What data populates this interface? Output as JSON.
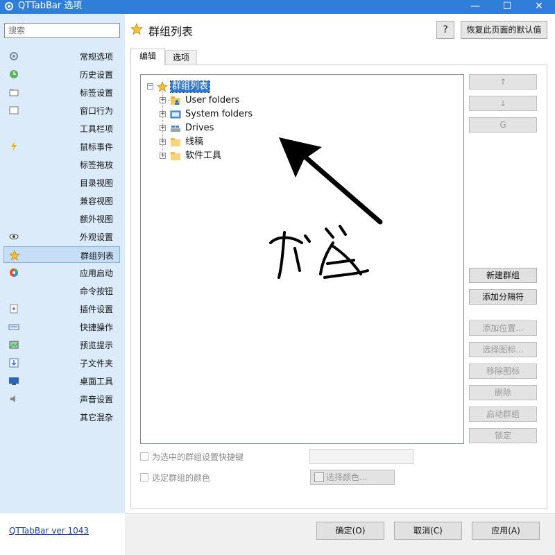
{
  "window": {
    "title": "QTTabBar 选项",
    "controls": {
      "minimize": "—",
      "maximize": "☐",
      "close": "✕"
    }
  },
  "sidebar": {
    "search_placeholder": "搜索",
    "items": [
      {
        "label": "常规选项",
        "icon": "gear-icon",
        "selected": false
      },
      {
        "label": "历史设置",
        "icon": "history-icon",
        "selected": false
      },
      {
        "label": "标签设置",
        "icon": "tab-icon",
        "selected": false
      },
      {
        "label": "窗口行为",
        "icon": "window-icon",
        "selected": false
      },
      {
        "label": "工具栏项",
        "icon": "",
        "selected": false
      },
      {
        "label": "鼠标事件",
        "icon": "lightning-icon",
        "selected": false
      },
      {
        "label": "标签拖放",
        "icon": "",
        "selected": false
      },
      {
        "label": "目录视图",
        "icon": "",
        "selected": false
      },
      {
        "label": "兼容视图",
        "icon": "",
        "selected": false
      },
      {
        "label": "额外视图",
        "icon": "",
        "selected": false
      },
      {
        "label": "外观设置",
        "icon": "eye-icon",
        "selected": false
      },
      {
        "label": "群组列表",
        "icon": "star-icon",
        "selected": true
      },
      {
        "label": "应用启动",
        "icon": "app-launch-icon",
        "selected": false
      },
      {
        "label": "命令按钮",
        "icon": "",
        "selected": false
      },
      {
        "label": "插件设置",
        "icon": "plugin-icon",
        "selected": false
      },
      {
        "label": "快捷操作",
        "icon": "keyboard-icon",
        "selected": false
      },
      {
        "label": "预览提示",
        "icon": "image-preview-icon",
        "selected": false
      },
      {
        "label": "子文件夹",
        "icon": "subfolder-arrow-icon",
        "selected": false
      },
      {
        "label": "桌面工具",
        "icon": "desktop-icon",
        "selected": false
      },
      {
        "label": "声音设置",
        "icon": "speaker-icon",
        "selected": false
      },
      {
        "label": "其它混杂",
        "icon": "",
        "selected": false
      }
    ],
    "version_link": "QTTabBar ver 1043"
  },
  "page": {
    "title": "群组列表",
    "help_label": "?",
    "reset_label": "恢复此页面的默认值",
    "tabs": [
      {
        "label": "编辑",
        "active": true
      },
      {
        "label": "选项",
        "active": false
      }
    ]
  },
  "tree": {
    "root": "群组列表",
    "children": [
      {
        "label": "User folders",
        "icon": "user-folder-icon"
      },
      {
        "label": "System folders",
        "icon": "system-folder-icon"
      },
      {
        "label": "Drives",
        "icon": "drive-icon"
      },
      {
        "label": "线稿",
        "icon": "folder-icon"
      },
      {
        "label": "软件工具",
        "icon": "folder-icon"
      }
    ]
  },
  "right_buttons": {
    "up": "↑",
    "down": "↓",
    "reset": "G",
    "new_group": "新建群组",
    "add_separator": "添加分隔符",
    "add_location": "添加位置...",
    "select_icon": "选择图标...",
    "remove_icon": "移除图标",
    "delete": "删除",
    "launch_group": "启动群组",
    "lock": "锁定"
  },
  "options": {
    "hotkey_label": "为选中的群组设置快捷键",
    "color_label": "选定群组的颜色",
    "select_color": "选择颜色..."
  },
  "footer": {
    "ok": "确定(O)",
    "cancel": "取消(C)",
    "apply": "应用(A)"
  },
  "colors": {
    "titlebar": "#2f7fd8",
    "sidebar": "#dcebfa",
    "selection": "#2b78d6"
  }
}
